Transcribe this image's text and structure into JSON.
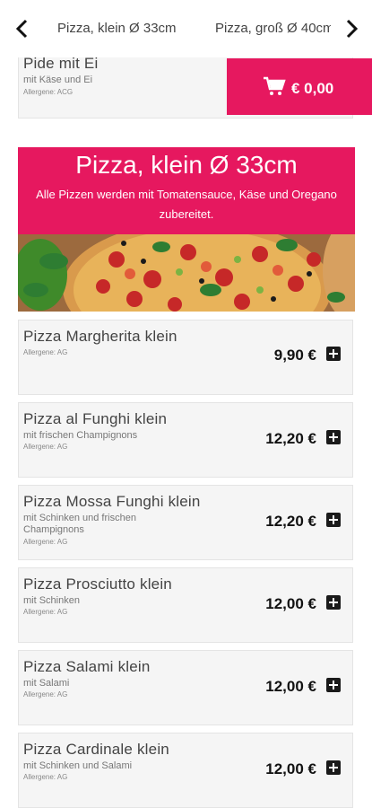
{
  "nav": {
    "tabs": [
      "Pizza, klein Ø 33cm",
      "Pizza, groß Ø 40cm"
    ]
  },
  "cart": {
    "total": "€ 0,00"
  },
  "previous_item": {
    "name": "Pide mit Ei",
    "description": "mit Käse und Ei",
    "allergen": "Allergene: ACG"
  },
  "category": {
    "title": "Pizza, klein Ø 33cm",
    "subtitle": "Alle Pizzen werden mit Tomatensauce, Käse und Oregano zubereitet."
  },
  "items": [
    {
      "name": "Pizza Margherita klein",
      "description": "",
      "allergen": "Allergene: AG",
      "price": "9,90 €"
    },
    {
      "name": "Pizza al Funghi klein",
      "description": "mit frischen Champignons",
      "allergen": "Allergene: AG",
      "price": "12,20 €"
    },
    {
      "name": "Pizza Mossa Funghi klein",
      "description": "mit Schinken und frischen Champignons",
      "allergen": "Allergene: AG",
      "price": "12,20 €"
    },
    {
      "name": "Pizza Prosciutto klein",
      "description": "mit Schinken",
      "allergen": "Allergene: AG",
      "price": "12,00 €"
    },
    {
      "name": "Pizza Salami klein",
      "description": "mit Salami",
      "allergen": "Allergene: AG",
      "price": "12,00 €"
    },
    {
      "name": "Pizza Cardinale klein",
      "description": "mit Schinken und Salami",
      "allergen": "Allergene: AG",
      "price": "12,00 €"
    }
  ],
  "colors": {
    "accent": "#e6185f",
    "card_bg": "#f5f5f5"
  }
}
